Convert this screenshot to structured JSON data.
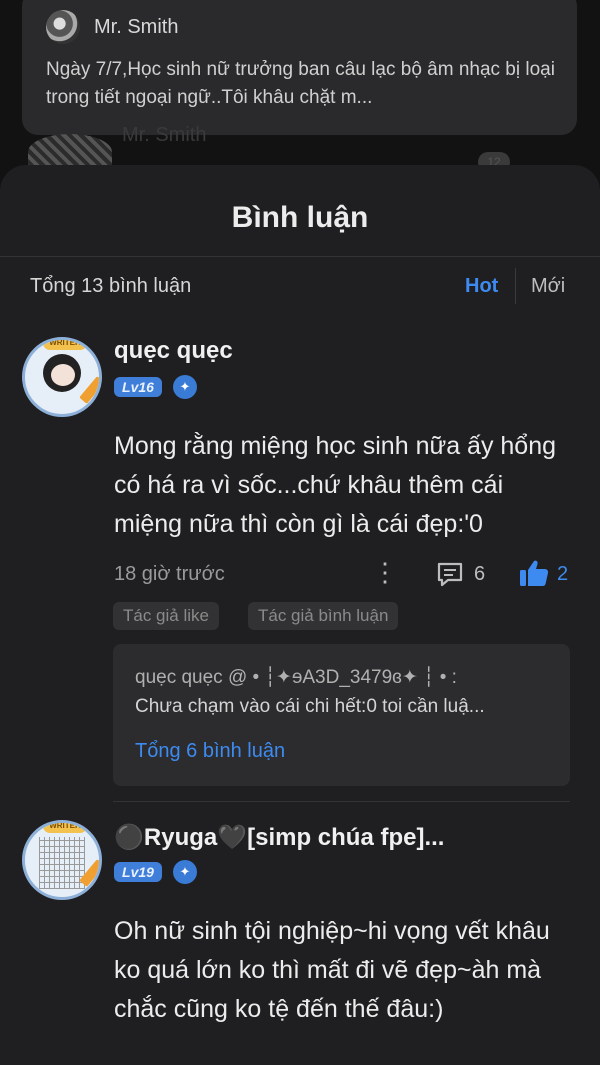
{
  "background_post": {
    "author": "Mr. Smith",
    "excerpt": "Ngày 7/7,Học sinh nữ trưởng ban câu lạc bộ âm nhạc bị loại trong tiết ngoại ngữ..Tôi khâu chặt m...",
    "ghost_author": "Mr. Smith",
    "ghost_count": "12"
  },
  "sheet": {
    "title": "Bình luận",
    "total": "Tổng 13 bình luận",
    "sort_hot": "Hot",
    "sort_new": "Mới"
  },
  "comments": [
    {
      "username": "quẹc quẹc",
      "level": "Lv16",
      "writer_badge": "WRITER",
      "text": "Mong rằng miệng học sinh nữa ấy hổng có há ra vì sốc...chứ khâu thêm cái miệng nữa thì còn gì là cái đẹp:'0",
      "time": "18 giờ trước",
      "reply_count": "6",
      "like_count": "2",
      "tags": [
        "Tác giả like",
        "Tác giả bình luận"
      ],
      "reply_preview": {
        "line1": "quẹc quẹc @ • ┆✦ɘA3D_3479ɞ✦ ┆ • :",
        "line2": "Chưa chạm vào cái chi hết:0 toi cần luậ...",
        "total": "Tổng 6 bình luận"
      }
    },
    {
      "username": "⚫Ryuga🖤[simp chúa fpe]...",
      "level": "Lv19",
      "writer_badge": "WRITER",
      "text": "Oh nữ sinh tội nghiệp~hi vọng vết khâu ko quá lớn ko thì mất đi vẽ đẹp~àh mà chắc cũng ko tệ đến thế đâu:)"
    }
  ],
  "colors": {
    "accent": "#3d8bf0",
    "sheet": "#1f1f21",
    "level": "#3f7fd9"
  },
  "icons": [
    "more-vertical-icon",
    "comment-icon",
    "thumbs-up-icon",
    "level-shield-icon",
    "pencil-icon"
  ]
}
